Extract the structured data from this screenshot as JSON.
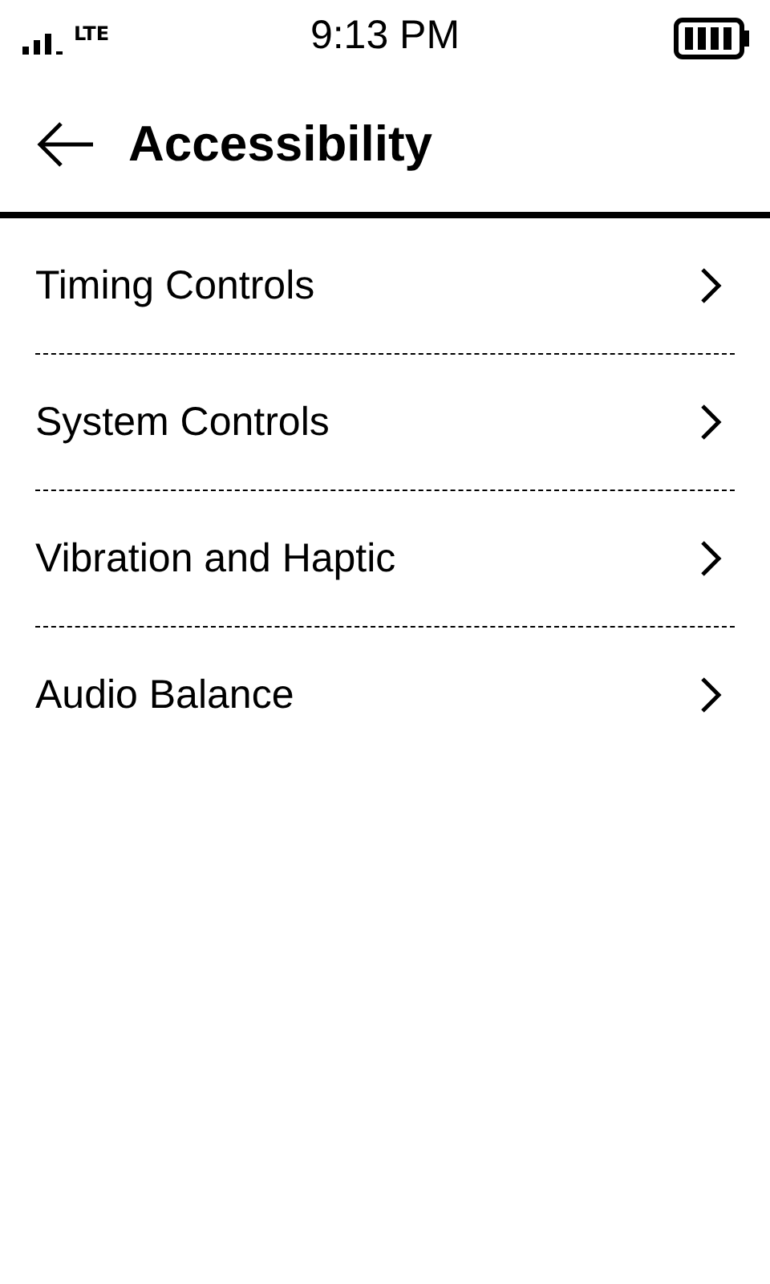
{
  "status_bar": {
    "network": "LTE",
    "time": "9:13 PM"
  },
  "header": {
    "title": "Accessibility"
  },
  "items": [
    {
      "label": "Timing Controls"
    },
    {
      "label": "System Controls"
    },
    {
      "label": "Vibration and Haptic"
    },
    {
      "label": "Audio Balance"
    }
  ]
}
